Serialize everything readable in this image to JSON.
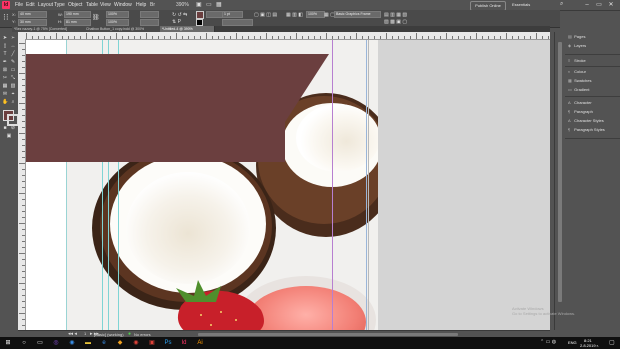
{
  "app": {
    "logo": "Id",
    "zoom": "390%",
    "publish_label": "Publish Online",
    "workspace": "Essentials"
  },
  "menu": [
    "File",
    "Edit",
    "Layout",
    "Type",
    "Object",
    "Table",
    "View",
    "Window",
    "Help"
  ],
  "control": {
    "x": "40 mm",
    "y": "30 mm",
    "w": "190 mm",
    "h": "81 mm",
    "scale": "100%",
    "stroke": "1 pt",
    "opacity": "100%",
    "font": "Basic Graphics Frame"
  },
  "tabs": [
    {
      "label": "*Bez nazwy-1 @ 75% [Converted]",
      "active": false
    },
    {
      "label": "Chatbox Button_1 copy.indd @ 300%",
      "active": false
    },
    {
      "label": "*Untitled-4 @ 390%",
      "active": true
    }
  ],
  "statusbar": {
    "page": "1",
    "preflight": "[Basic] (working)",
    "errors": "No errors"
  },
  "panels": [
    {
      "group": "nav",
      "items": [
        {
          "icon": "pages-icon",
          "glyph": "▤",
          "label": "Pages"
        },
        {
          "icon": "layers-icon",
          "glyph": "◈",
          "label": "Layers"
        }
      ]
    },
    {
      "group": "stroke",
      "items": [
        {
          "icon": "stroke-icon",
          "glyph": "≡",
          "label": "Stroke"
        }
      ]
    },
    {
      "group": "color",
      "items": [
        {
          "icon": "color-icon",
          "glyph": "◐",
          "label": "Colour"
        },
        {
          "icon": "swatches-icon",
          "glyph": "▦",
          "label": "Swatches"
        },
        {
          "icon": "gradient-icon",
          "glyph": "▭",
          "label": "Gradient"
        }
      ]
    },
    {
      "group": "type",
      "items": [
        {
          "icon": "character-icon",
          "glyph": "A",
          "label": "Character"
        },
        {
          "icon": "paragraph-icon",
          "glyph": "¶",
          "label": "Paragraph"
        },
        {
          "icon": "character-styles-icon",
          "glyph": "A",
          "label": "Character Styles"
        },
        {
          "icon": "paragraph-styles-icon",
          "glyph": "¶",
          "label": "Paragraph Styles"
        }
      ]
    }
  ],
  "watermark": {
    "line1": "Activate Windows",
    "line2": "Go to Settings to activate Windows."
  },
  "clock": {
    "time": "8:21",
    "date": "2.8.2019 r."
  },
  "tray": {
    "lang": "ENG"
  },
  "colors": {
    "banner": "#6b3f3f",
    "fill_swatch": "#6b3f3f",
    "ui_bg": "#535353",
    "guide_cyan": "#7fd4d4",
    "guide_magenta": "#b77fd0"
  }
}
